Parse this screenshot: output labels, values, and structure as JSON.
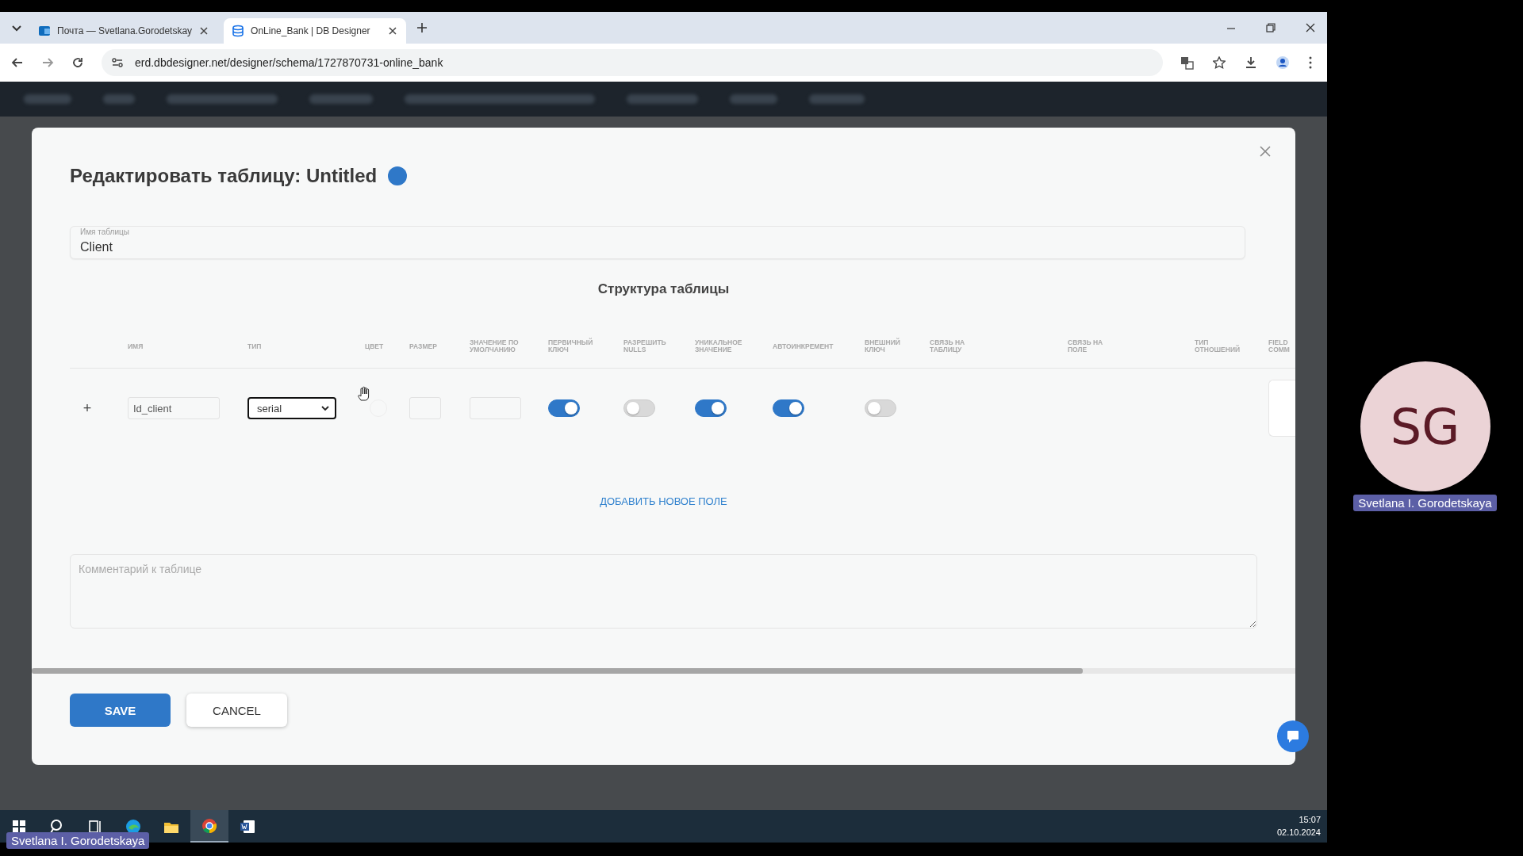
{
  "browser": {
    "tabs": [
      {
        "title": "Почта — Svetlana.Gorodetskay",
        "kind": "mail",
        "selected": false
      },
      {
        "title": "OnLine_Bank | DB Designer",
        "kind": "db",
        "selected": true
      }
    ],
    "url": "erd.dbdesigner.net/designer/schema/1727870731-online_bank"
  },
  "modal": {
    "title": "Редактировать таблицу: Untitled",
    "table_name": {
      "label": "Имя таблицы",
      "value": "Client"
    },
    "section_title": "Структура таблицы",
    "columns": [
      "ИМЯ",
      "ТИП",
      "ЦВЕТ",
      "РАЗМЕР",
      "ЗНАЧЕНИЕ ПО УМОЛЧАНИЮ",
      "ПЕРВИЧНЫЙ КЛЮЧ",
      "РАЗРЕШИТЬ NULLS",
      "УНИКАЛЬНОЕ ЗНАЧЕНИЕ",
      "АВТОИНКРЕМЕНТ",
      "ВНЕШНИЙ КЛЮЧ",
      "СВЯЗЬ НА ТАБЛИЦУ",
      "СВЯЗЬ НА ПОЛЕ",
      "ТИП ОТНОШЕНИЙ",
      "FIELD COMM"
    ],
    "fields": [
      {
        "add": "+",
        "name": "Id_client",
        "type": "serial",
        "primary_key": true,
        "nulls": false,
        "unique": true,
        "autoincrement": true,
        "foreign_key": false
      }
    ],
    "add_field": "ДОБАВИТЬ НОВОЕ ПОЛЕ",
    "comment": {
      "placeholder": "Комментарий к таблице"
    },
    "buttons": [
      {
        "label": "SAVE",
        "kind": "primary"
      },
      {
        "label": "CANCEL",
        "kind": "secondary"
      }
    ]
  },
  "taskbar": {
    "apps": [
      {
        "kind": "start",
        "selected": false
      },
      {
        "kind": "search",
        "selected": false
      },
      {
        "kind": "taskview",
        "selected": false
      },
      {
        "kind": "edge",
        "selected": false
      },
      {
        "kind": "explorer",
        "selected": false
      },
      {
        "kind": "chrome",
        "selected": true
      },
      {
        "kind": "word",
        "selected": false
      }
    ],
    "clock": {
      "time": "15:07",
      "date": "02.10.2024"
    }
  },
  "presenter_label": "Svetlana I. Gorodetskaya",
  "participant": {
    "initials": "SG",
    "name": "Svetlana I. Gorodetskaya"
  }
}
